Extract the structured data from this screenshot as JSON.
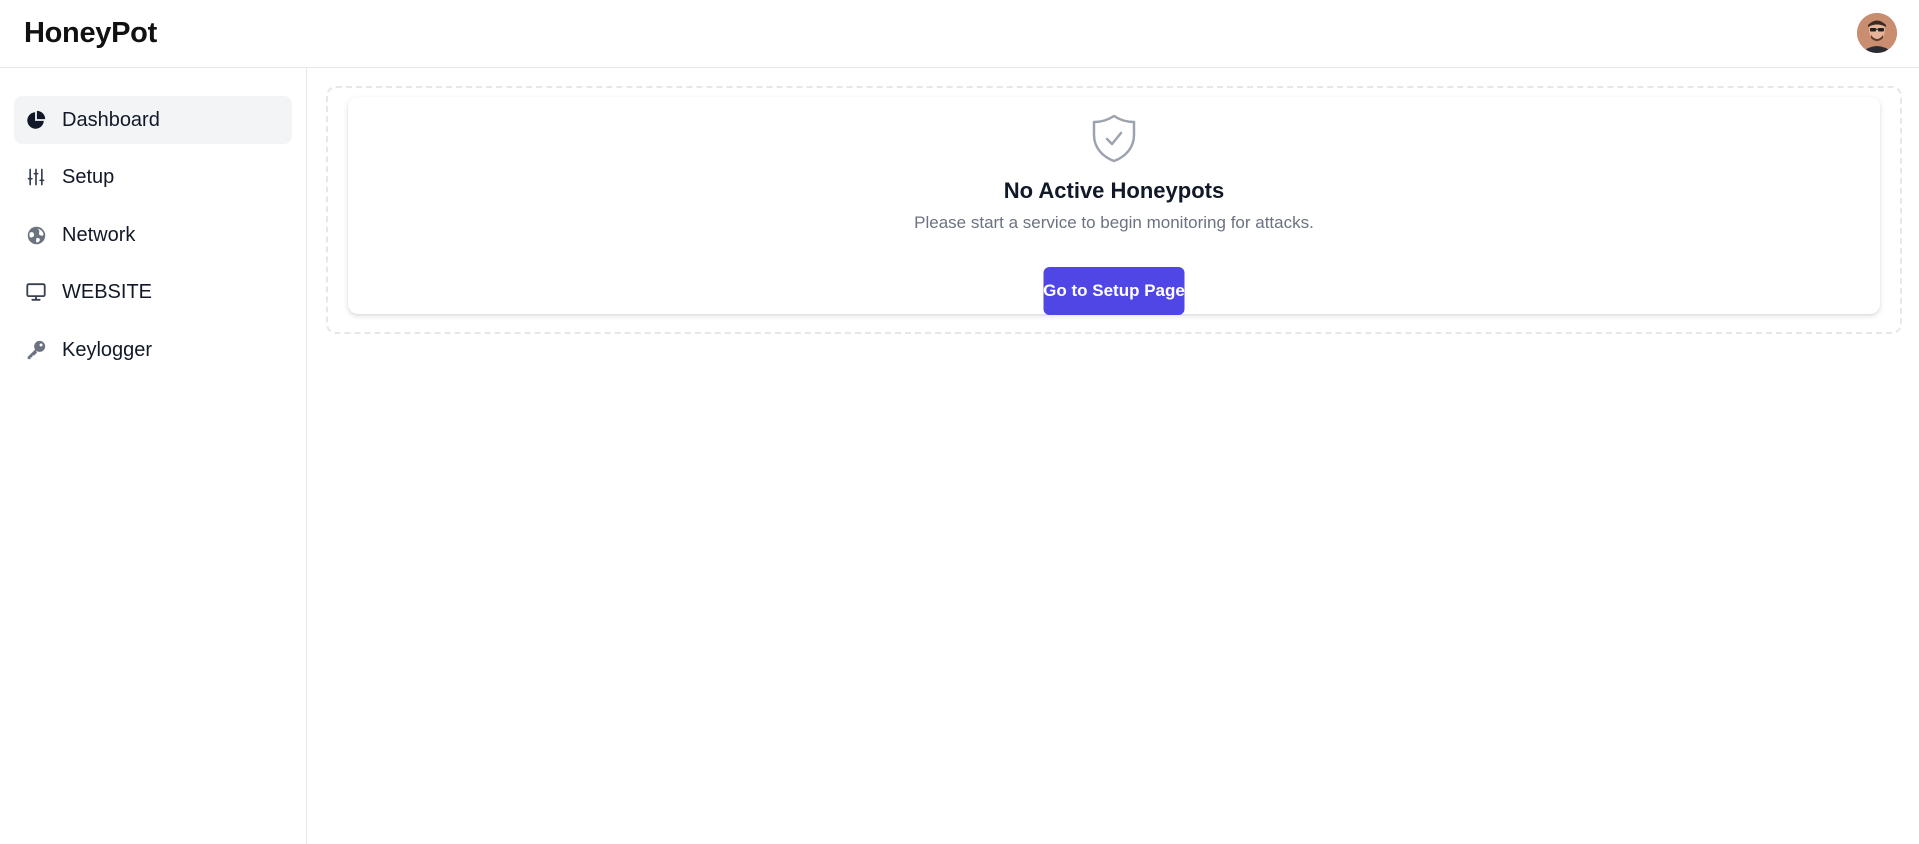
{
  "app": {
    "title": "HoneyPot"
  },
  "header": {
    "avatar_icon": "user-avatar"
  },
  "sidebar": {
    "items": [
      {
        "label": "Dashboard",
        "icon": "pie-chart-icon",
        "active": true
      },
      {
        "label": "Setup",
        "icon": "sliders-icon",
        "active": false
      },
      {
        "label": "Network",
        "icon": "globe-icon",
        "active": false
      },
      {
        "label": "WEBSITE",
        "icon": "monitor-icon",
        "active": false
      },
      {
        "label": "Keylogger",
        "icon": "key-icon",
        "active": false
      }
    ]
  },
  "main": {
    "empty_state": {
      "icon": "shield-check-icon",
      "title": "No Active Honeypots",
      "subtitle": "Please start a service to begin monitoring for attacks.",
      "button_label": "Go to Setup Page"
    }
  },
  "colors": {
    "accent": "#4f46e5",
    "active_nav_bg": "#f3f4f6",
    "border": "#e5e7eb",
    "muted_text": "#6b7280",
    "icon_gray": "#9ca3af"
  }
}
